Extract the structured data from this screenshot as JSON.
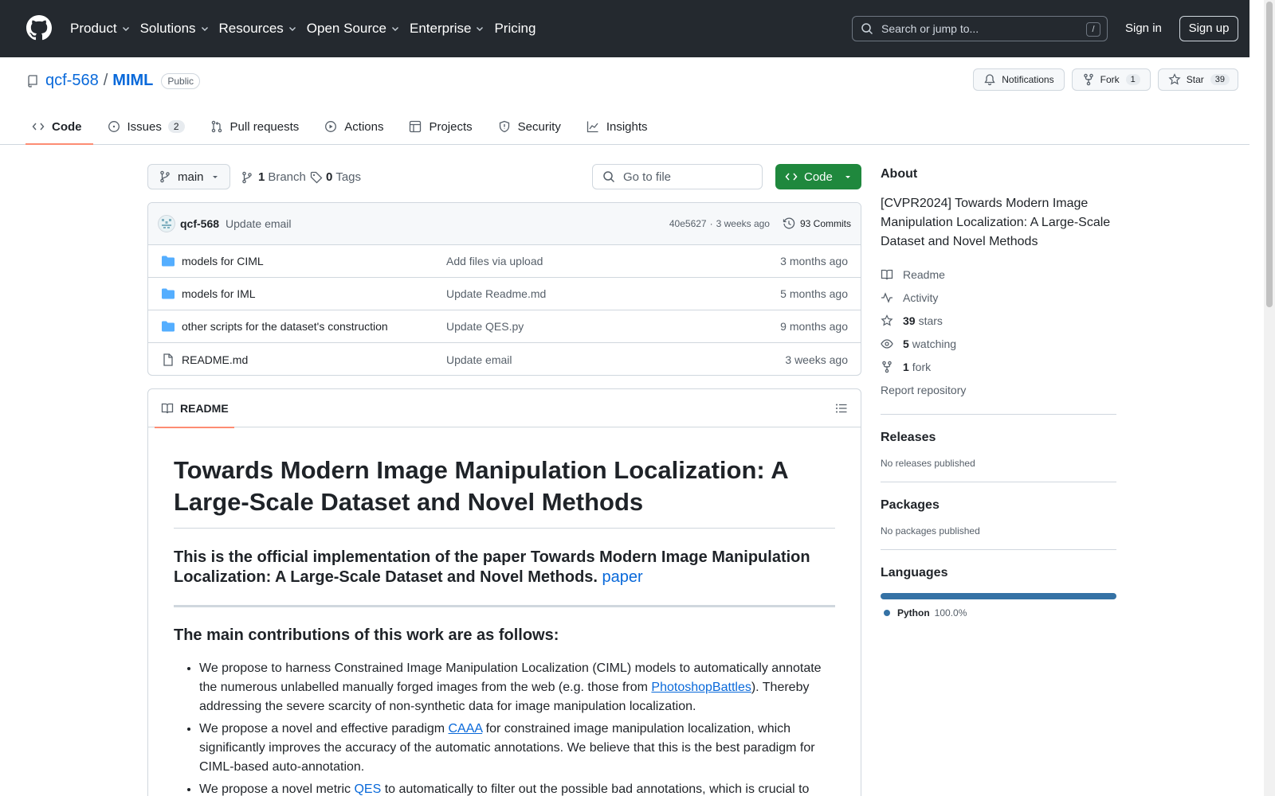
{
  "header": {
    "nav": [
      "Product",
      "Solutions",
      "Resources",
      "Open Source",
      "Enterprise",
      "Pricing"
    ],
    "search_placeholder": "Search or jump to...",
    "search_key": "/",
    "sign_in": "Sign in",
    "sign_up": "Sign up"
  },
  "repo": {
    "owner": "qcf-568",
    "separator": "/",
    "name": "MIML",
    "visibility": "Public",
    "notifications_label": "Notifications",
    "fork_label": "Fork",
    "fork_count": "1",
    "star_label": "Star",
    "star_count": "39"
  },
  "tabs": [
    {
      "label": "Code",
      "active": true
    },
    {
      "label": "Issues",
      "count": "2"
    },
    {
      "label": "Pull requests"
    },
    {
      "label": "Actions"
    },
    {
      "label": "Projects"
    },
    {
      "label": "Security"
    },
    {
      "label": "Insights"
    }
  ],
  "toolbar": {
    "branch": "main",
    "branches_count": "1",
    "branches_label": "Branch",
    "tags_count": "0",
    "tags_label": "Tags",
    "goto_placeholder": "Go to file",
    "code_label": "Code"
  },
  "latest_commit": {
    "author": "qcf-568",
    "message": "Update email",
    "hash": "40e5627",
    "dot": "·",
    "age": "3 weeks ago",
    "commits_label": "93 Commits"
  },
  "files": [
    {
      "name": "models for CIML",
      "type": "folder",
      "message": "Add files via upload",
      "age": "3 months ago"
    },
    {
      "name": "models for IML",
      "type": "folder",
      "message": "Update Readme.md",
      "age": "5 months ago"
    },
    {
      "name": "other scripts for the dataset's construction",
      "type": "folder",
      "message": "Update QES.py",
      "age": "9 months ago"
    },
    {
      "name": "README.md",
      "type": "file",
      "message": "Update email",
      "age": "3 weeks ago"
    }
  ],
  "readme": {
    "tab_label": "README",
    "h1": "Towards Modern Image Manipulation Localization: A Large-Scale Dataset and Novel Methods",
    "h3_text": "This is the official implementation of the paper Towards Modern Image Manipulation Localization: A Large-Scale Dataset and Novel Methods.",
    "h3_link": "paper",
    "h4": "The main contributions of this work are as follows:",
    "bullets": [
      {
        "pre": "We propose to harness Constrained Image Manipulation Localization (CIML) models to automatically annotate the numerous unlabelled manually forged images from the web (e.g. those from ",
        "link": "PhotoshopBattles",
        "post": "). Thereby addressing the severe scarcity of non-synthetic data for image manipulation localization."
      },
      {
        "pre": "We propose a novel and effective paradigm ",
        "link": "CAAA",
        "post": " for constrained image manipulation localization, which significantly improves the accuracy of the automatic annotations. We believe that this is the best paradigm for CIML-based auto-annotation."
      },
      {
        "pre": "We propose a novel metric ",
        "link": "QES",
        "post": " to automatically to filter out the possible bad annotations, which is crucial to"
      }
    ]
  },
  "sidebar": {
    "about_title": "About",
    "description": "[CVPR2024] Towards Modern Image Manipulation Localization: A Large-Scale Dataset and Novel Methods",
    "readme_label": "Readme",
    "activity_label": "Activity",
    "stars_count": "39",
    "stars_label": "stars",
    "watching_count": "5",
    "watching_label": "watching",
    "fork_count": "1",
    "fork_label": "fork",
    "report_label": "Report repository",
    "releases_title": "Releases",
    "releases_none": "No releases published",
    "packages_title": "Packages",
    "packages_none": "No packages published",
    "languages_title": "Languages",
    "language_name": "Python",
    "language_percent": "100.0%",
    "language_color": "#3572a5"
  }
}
